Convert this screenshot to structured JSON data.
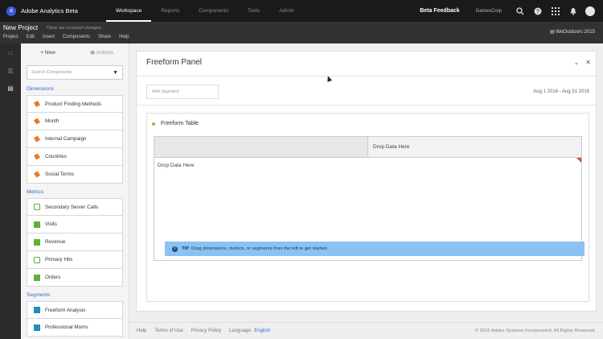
{
  "app": {
    "name": "Adobe Analytics Beta",
    "logo_letter": "a"
  },
  "topnav": {
    "items": [
      {
        "label": "Workspace"
      },
      {
        "label": "Reports"
      },
      {
        "label": "Components"
      },
      {
        "label": "Tools"
      },
      {
        "label": "Admin"
      }
    ],
    "beta_feedback": "Beta Feedback",
    "company": "GamesCorp"
  },
  "project": {
    "title": "New Project",
    "unsaved": "There are unsaved changes.",
    "menu": [
      "Project",
      "Edit",
      "Insert",
      "Components",
      "Share",
      "Help"
    ],
    "report_suite": "WeOutdoors 2015"
  },
  "components": {
    "new_label": "New",
    "actions_label": "Actions",
    "search_placeholder": "Search Components",
    "dimensions_label": "Dimensions",
    "dimensions": [
      {
        "label": "Product Finding Methods"
      },
      {
        "label": "Month"
      },
      {
        "label": "Internal Campaign"
      },
      {
        "label": "Countries"
      },
      {
        "label": "Social Terms"
      }
    ],
    "metrics_label": "Metrics",
    "metrics": [
      {
        "label": "Secondary Server Calls"
      },
      {
        "label": "Visits"
      },
      {
        "label": "Revenue"
      },
      {
        "label": "Primary Hits"
      },
      {
        "label": "Orders"
      }
    ],
    "segments_label": "Segments",
    "segments": [
      {
        "label": "Freeform Analysis"
      },
      {
        "label": "Professional Moms"
      }
    ]
  },
  "panel": {
    "title": "Freeform Panel",
    "add_segment_placeholder": "Add Segment",
    "date_range": "Aug 1 2016 - Aug 31 2016",
    "table": {
      "title": "Freeform Table",
      "header_drop": "Drop Data Here",
      "row_drop": "Drop Data Here",
      "tip_label": "TIP",
      "tip_text": "Drag dimensions, metrics, or segments from the left to get started."
    }
  },
  "footer": {
    "links": [
      "Help",
      "Terms of Use",
      "Privacy Policy"
    ],
    "language_label": "Language:",
    "language_value": "English",
    "copyright": "© 2016 Adobe Systems Incorporated. All Rights Reserved."
  },
  "colors": {
    "accent": "#2d6fc7",
    "tip_bg": "#8cc2f2",
    "dimension_icon": "#e37a2a",
    "metric_icon": "#5fb03a",
    "segment_icon": "#1f8fb3"
  }
}
